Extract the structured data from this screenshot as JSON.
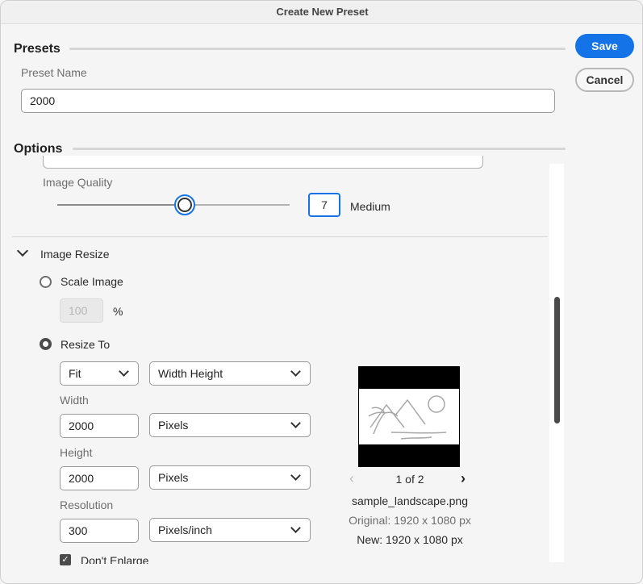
{
  "window": {
    "title": "Create New Preset"
  },
  "presets": {
    "section_title": "Presets",
    "name_label": "Preset Name",
    "name_value": "2000"
  },
  "actions": {
    "save_label": "Save",
    "cancel_label": "Cancel"
  },
  "options": {
    "section_title": "Options",
    "image_quality": {
      "label": "Image Quality",
      "value": "7",
      "level": "Medium",
      "slider_fraction": 0.55
    },
    "image_resize": {
      "title": "Image Resize",
      "scale_image": {
        "label": "Scale Image",
        "selected": false,
        "value": "100",
        "unit": "%"
      },
      "resize_to": {
        "label": "Resize To",
        "selected": true,
        "fit_mode": "Fit",
        "dimension_mode": "Width Height",
        "width_label": "Width",
        "width_value": "2000",
        "width_unit": "Pixels",
        "height_label": "Height",
        "height_value": "2000",
        "height_unit": "Pixels",
        "resolution_label": "Resolution",
        "resolution_value": "300",
        "resolution_unit": "Pixels/inch",
        "dont_enlarge_label": "Don't Enlarge",
        "dont_enlarge_checked": true
      }
    }
  },
  "preview": {
    "pager": "1 of 2",
    "filename": "sample_landscape.png",
    "original": "Original: 1920 x 1080 px",
    "new": "New: 1920 x 1080 px"
  },
  "colors": {
    "accent": "#1473e6",
    "background": "#f5f5f5",
    "dark_control": "#4b4b4b"
  },
  "icons": {
    "chevron": "chevron-down-icon",
    "checkmark": "checkmark-icon",
    "prev": "chevron-left-icon",
    "next": "chevron-right-icon",
    "thumbnail": "landscape-image-icon"
  }
}
